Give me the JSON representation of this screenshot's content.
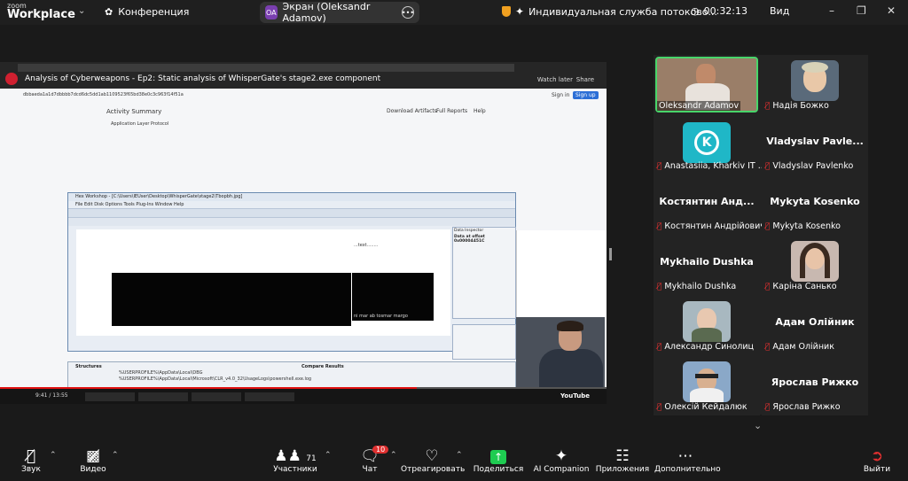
{
  "topbar": {
    "logo_small": "zoom",
    "logo_big": "Workplace",
    "meeting": "Конференция",
    "screen_avatar": "OA",
    "screen_label": "Экран (Oleksandr Adamov)",
    "service": "Индивидуальная служба потоково...",
    "timer": "00:32:13",
    "view": "Вид"
  },
  "shared": {
    "video_title": "Analysis of Cyberweapons - Ep2: Static analysis of WhisperGate's stage2.exe component",
    "watch_later": "Watch later",
    "share": "Share",
    "url_text": "dbbaeda1a1d7dbbbb7dcd6dc5dd1ab1109523f65bd38e0c3c963f14f51a",
    "sign_in": "Sign in",
    "sign_up": "Sign up",
    "activity_summary": "Activity Summary",
    "download_artifacts": "Download Artifacts",
    "full_reports": "Full Reports",
    "help": "Help",
    "protocol": "Application Layer Protocol",
    "hex_title": "Hex Workshop - [C:\\Users\\IEUser\\Desktop\\WhisperGate\\stage2\\Tbopbh.jpg]",
    "hex_menu": "File  Edit  Disk  Options  Tools  Plug-Ins  Window  Help",
    "data_inspector": "Data Inspector",
    "data_offset": "Data at offset 0x00004451C",
    "structures": "Structures",
    "compare_results": "Compare Results",
    "ascii_snippet": "...text........",
    "ascii2": "ni mar ab tosmar margo",
    "path1": "%USERPROFILE%\\AppData\\Local\\DBG",
    "path2": "%USERPROFILE%\\AppData\\Local\\Microsoft\\CLR_v4.0_32\\UsageLogs\\powershell.exe.log",
    "yt_time": "9:41 / 13:55",
    "youtube": "YouTube"
  },
  "participants": [
    {
      "name": "Oleksandr Adamov",
      "mic_muted": false,
      "kind": "video"
    },
    {
      "name": "Надія Божко",
      "mic_muted": true,
      "kind": "photo"
    },
    {
      "name": "Anastasiia, Kharkiv IT ...",
      "mic_muted": true,
      "kind": "logo"
    },
    {
      "name": "Vladyslav Pavlenko",
      "big": "Vladyslav  Pavle...",
      "mic_muted": true,
      "kind": "name"
    },
    {
      "name": "Костянтин Андрійович",
      "big": "Костянтин  Анд...",
      "mic_muted": true,
      "kind": "name"
    },
    {
      "name": "Mykyta Kosenko",
      "big": "Mykyta Kosenko",
      "mic_muted": true,
      "kind": "name"
    },
    {
      "name": "Mykhailo Dushka",
      "big": "Mykhailo Dushka",
      "mic_muted": true,
      "kind": "name"
    },
    {
      "name": "Каріна Санько",
      "mic_muted": true,
      "kind": "photo"
    },
    {
      "name": "Александр Синолиц",
      "mic_muted": true,
      "kind": "photo"
    },
    {
      "name": "Адам Олійник",
      "big": "Адам Олійник",
      "mic_muted": true,
      "kind": "name"
    },
    {
      "name": "Олексій Кейдалюк",
      "mic_muted": true,
      "kind": "photo"
    },
    {
      "name": "Ярослав Рижко",
      "big": "Ярослав Рижко",
      "mic_muted": true,
      "kind": "name"
    }
  ],
  "toolbar": {
    "audio": "Звук",
    "video": "Видео",
    "participants": "Участники",
    "participants_count": "71",
    "chat": "Чат",
    "chat_badge": "10",
    "react": "Отреагировать",
    "share": "Поделиться",
    "ai": "AI Companion",
    "apps": "Приложения",
    "more": "Дополнительно",
    "leave": "Выйти"
  },
  "colors": {
    "accent_green": "#48d56a",
    "share_green": "#1ecc51",
    "muted_red": "#e03030",
    "bg": "#1a1a1a"
  }
}
